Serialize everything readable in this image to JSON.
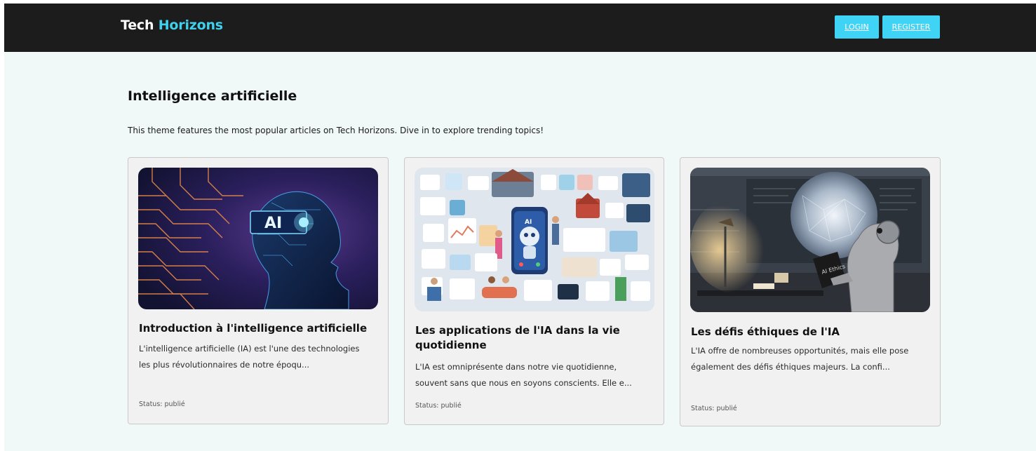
{
  "header": {
    "brand_part1": "Tech",
    "brand_part2": "Horizons",
    "login_label": "LOGIN",
    "register_label": "REGISTER"
  },
  "theme": {
    "title": "Intelligence artificielle",
    "description": "This theme features the most popular articles on Tech Horizons. Dive in to explore trending topics!"
  },
  "articles": [
    {
      "title": "Introduction à l'intelligence artificielle",
      "excerpt": "L'intelligence artificielle (IA) est l'une des technologies les plus révolutionnaires de notre époqu...",
      "status": "Status: publié",
      "image_text": "AI"
    },
    {
      "title": "Les applications de l'IA dans la vie quotidienne",
      "excerpt": "L'IA est omniprésente dans notre vie quotidienne, souvent sans que nous en soyons conscients. Elle e...",
      "status": "Status: publié",
      "image_text": "AI"
    },
    {
      "title": "Les défis éthiques de l'IA",
      "excerpt": "L'IA offre de nombreuses opportunités, mais elle pose également des défis éthiques majeurs. La confi...",
      "status": "Status: publié",
      "image_text": "AI Ethics"
    }
  ],
  "colors": {
    "header_bg": "#1c1c1c",
    "accent": "#3fd4f5",
    "page_bg": "#f1f8f8",
    "card_bg": "#f1f1f1"
  }
}
